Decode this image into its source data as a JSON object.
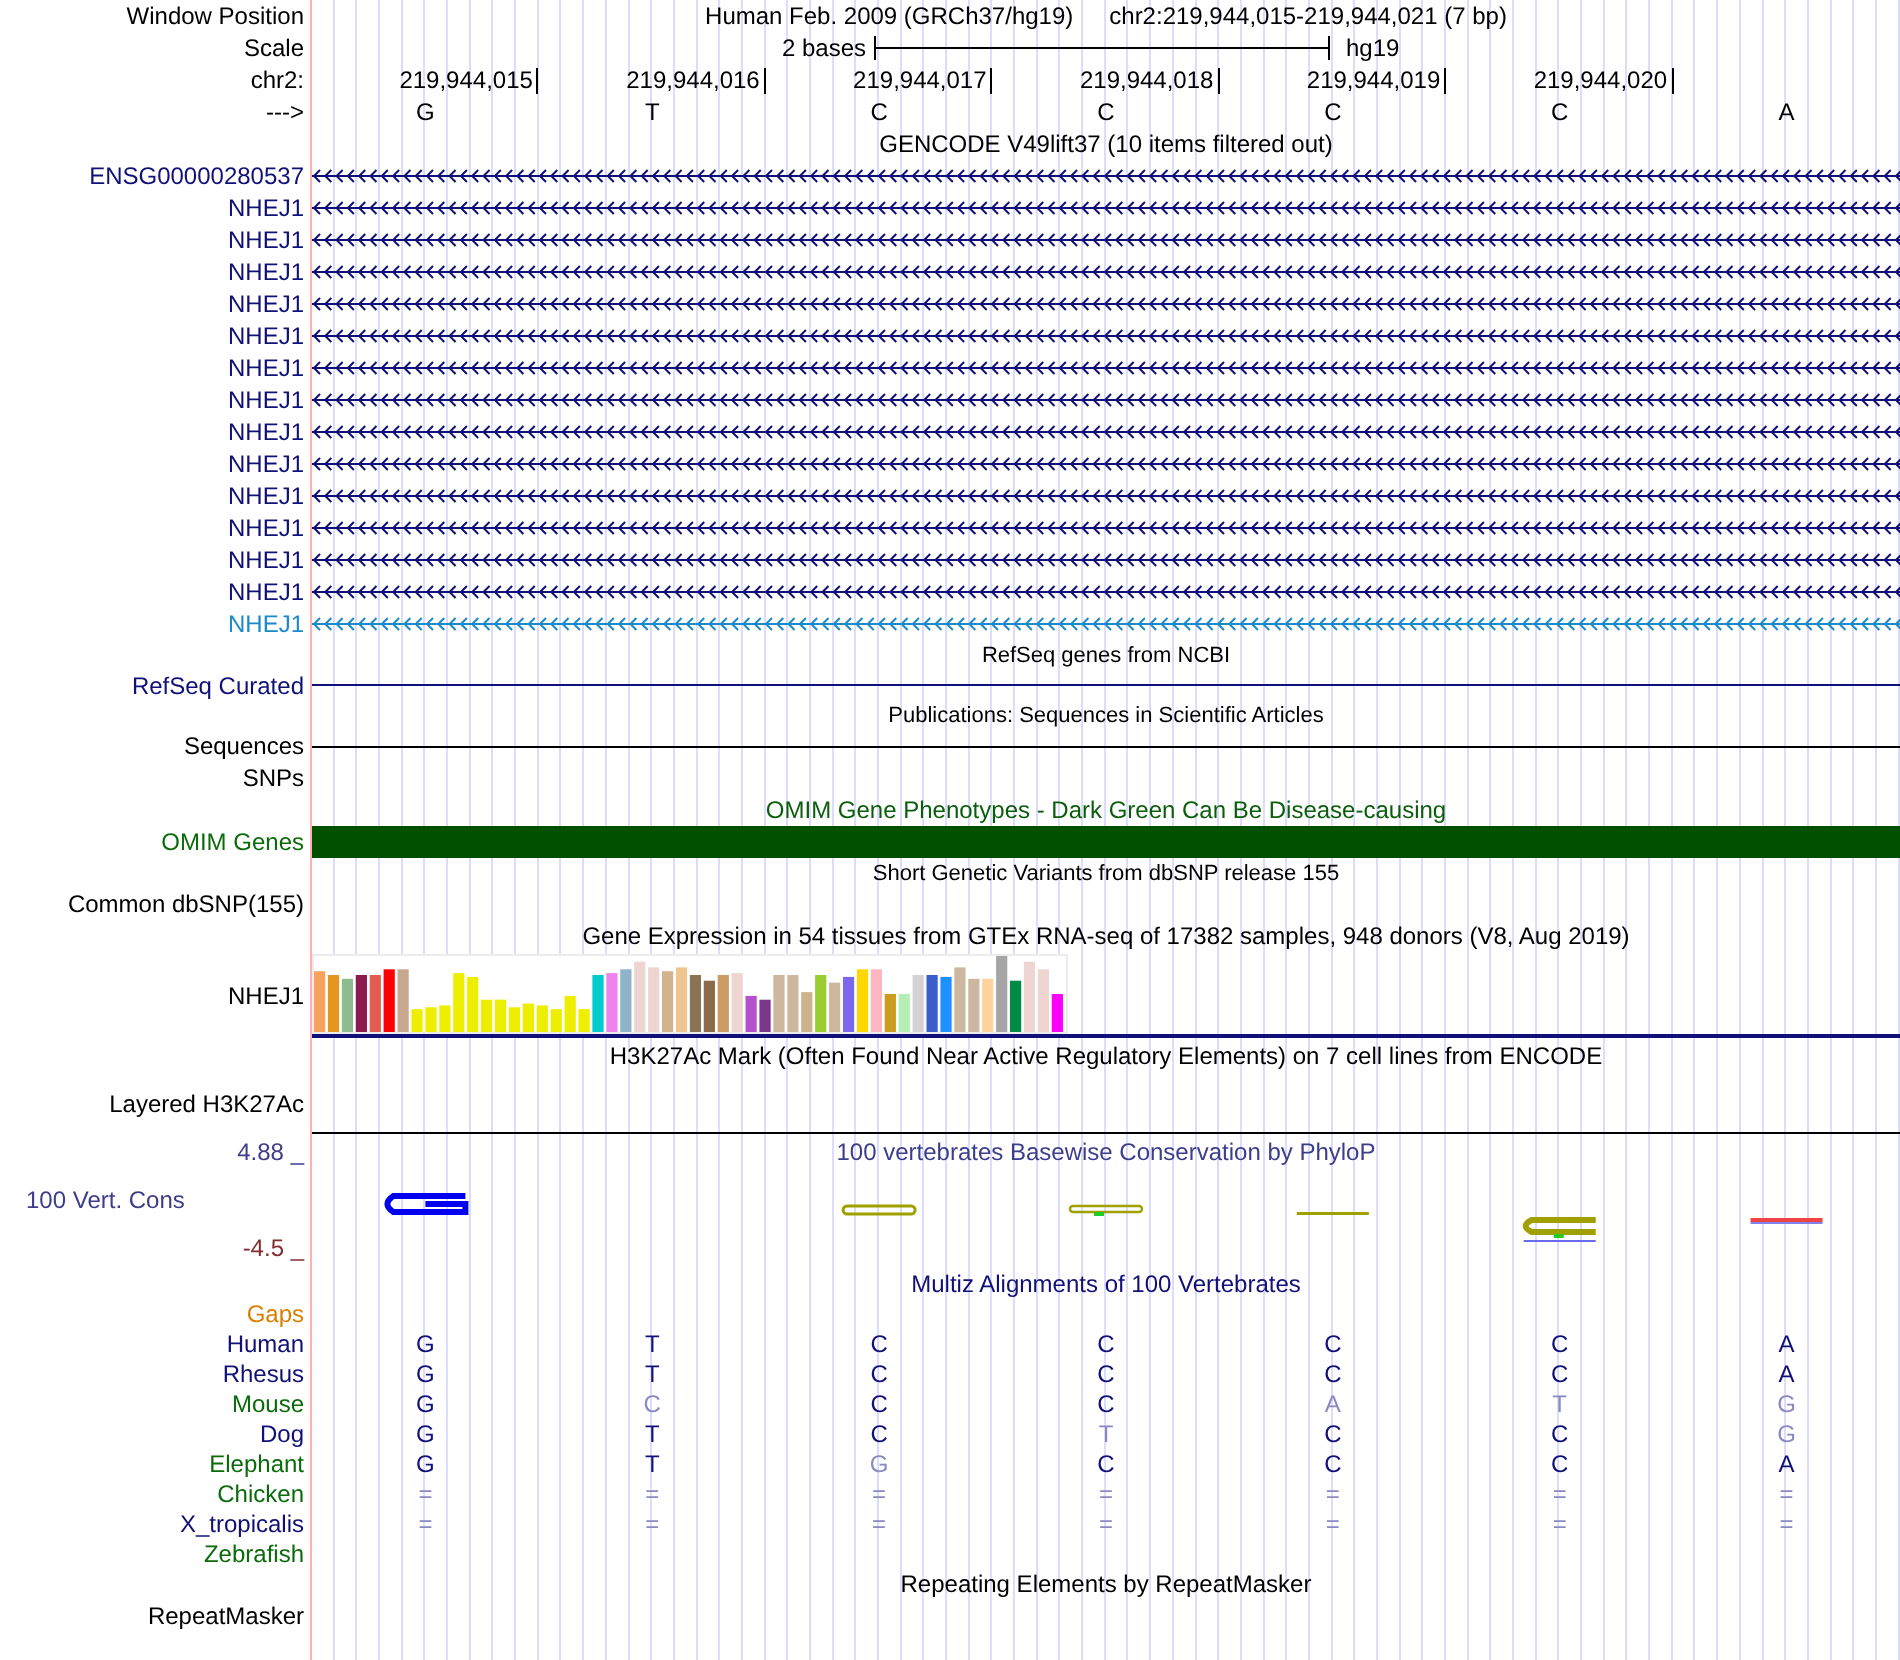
{
  "header": {
    "label": "Window Position",
    "assembly": "Human Feb. 2009 (GRCh37/hg19)",
    "position": "chr2:219,944,015-219,944,021 (7 bp)"
  },
  "scale": {
    "label": "Scale",
    "length": "2 bases",
    "assembly": "hg19"
  },
  "ruler": {
    "label": "chr2:",
    "positions": [
      "219,944,015",
      "219,944,016",
      "219,944,017",
      "219,944,018",
      "219,944,019",
      "219,944,020"
    ]
  },
  "sequence": {
    "label": "--->",
    "bases": [
      "G",
      "T",
      "C",
      "C",
      "C",
      "C",
      "A"
    ]
  },
  "gencode": {
    "title": "GENCODE V49lift37 (10 items filtered out)",
    "genes": [
      {
        "name": "ENSG00000280537",
        "color": "#101078"
      },
      {
        "name": "NHEJ1",
        "color": "#101078"
      },
      {
        "name": "NHEJ1",
        "color": "#101078"
      },
      {
        "name": "NHEJ1",
        "color": "#101078"
      },
      {
        "name": "NHEJ1",
        "color": "#101078"
      },
      {
        "name": "NHEJ1",
        "color": "#101078"
      },
      {
        "name": "NHEJ1",
        "color": "#101078"
      },
      {
        "name": "NHEJ1",
        "color": "#101078"
      },
      {
        "name": "NHEJ1",
        "color": "#101078"
      },
      {
        "name": "NHEJ1",
        "color": "#101078"
      },
      {
        "name": "NHEJ1",
        "color": "#101078"
      },
      {
        "name": "NHEJ1",
        "color": "#101078"
      },
      {
        "name": "NHEJ1",
        "color": "#101078"
      },
      {
        "name": "NHEJ1",
        "color": "#101078"
      },
      {
        "name": "NHEJ1",
        "color": "#1a8acb"
      }
    ]
  },
  "refseq": {
    "title": "RefSeq genes from NCBI",
    "label": "RefSeq Curated"
  },
  "publications": {
    "title": "Publications: Sequences in Scientific Articles",
    "label": "Sequences"
  },
  "snps": {
    "label": "SNPs"
  },
  "omim": {
    "title": "OMIM Gene Phenotypes - Dark Green Can Be Disease-causing",
    "label": "OMIM Genes"
  },
  "dbsnp": {
    "title": "Short Genetic Variants from dbSNP release 155",
    "label": "Common dbSNP(155)"
  },
  "gtex": {
    "title": "Gene Expression in 54 tissues from GTEx RNA-seq of 17382 samples, 948 donors (V8, Aug 2019)",
    "label": "NHEJ1"
  },
  "h3k27ac": {
    "title": "H3K27Ac Mark (Often Found Near Active Regulatory Elements) on 7 cell lines from ENCODE",
    "label": "Layered H3K27Ac"
  },
  "conservation": {
    "title": "100 vertebrates Basewise Conservation by PhyloP",
    "label": "100 Vert. Cons",
    "max": "4.88 _",
    "min": "-4.5 _"
  },
  "multiz": {
    "title": "Multiz Alignments of 100 Vertebrates",
    "gaps_label": "Gaps",
    "species": [
      {
        "name": "Human",
        "color": "#101078",
        "bases": [
          {
            "base": "G",
            "match": true
          },
          {
            "base": "T",
            "match": true
          },
          {
            "base": "C",
            "match": true
          },
          {
            "base": "C",
            "match": true
          },
          {
            "base": "C",
            "match": true
          },
          {
            "base": "C",
            "match": true
          },
          {
            "base": "A",
            "match": true
          }
        ]
      },
      {
        "name": "Rhesus",
        "color": "#101078",
        "bases": [
          {
            "base": "G",
            "match": true
          },
          {
            "base": "T",
            "match": true
          },
          {
            "base": "C",
            "match": true
          },
          {
            "base": "C",
            "match": true
          },
          {
            "base": "C",
            "match": true
          },
          {
            "base": "C",
            "match": true
          },
          {
            "base": "A",
            "match": true
          }
        ]
      },
      {
        "name": "Mouse",
        "color": "#0b6b0b",
        "bases": [
          {
            "base": "G",
            "match": true
          },
          {
            "base": "C",
            "match": false
          },
          {
            "base": "C",
            "match": true
          },
          {
            "base": "C",
            "match": true
          },
          {
            "base": "A",
            "match": false
          },
          {
            "base": "T",
            "match": false
          },
          {
            "base": "G",
            "match": false
          }
        ]
      },
      {
        "name": "Dog",
        "color": "#101078",
        "bases": [
          {
            "base": "G",
            "match": true
          },
          {
            "base": "T",
            "match": true
          },
          {
            "base": "C",
            "match": true
          },
          {
            "base": "T",
            "match": false
          },
          {
            "base": "C",
            "match": true
          },
          {
            "base": "C",
            "match": true
          },
          {
            "base": "G",
            "match": false
          }
        ]
      },
      {
        "name": "Elephant",
        "color": "#0b6b0b",
        "bases": [
          {
            "base": "G",
            "match": true
          },
          {
            "base": "T",
            "match": true
          },
          {
            "base": "G",
            "match": false
          },
          {
            "base": "C",
            "match": true
          },
          {
            "base": "C",
            "match": true
          },
          {
            "base": "C",
            "match": true
          },
          {
            "base": "A",
            "match": true
          }
        ]
      },
      {
        "name": "Chicken",
        "color": "#0b6b0b",
        "bases": [
          {
            "base": "=",
            "match": false
          },
          {
            "base": "=",
            "match": false
          },
          {
            "base": "=",
            "match": false
          },
          {
            "base": "=",
            "match": false
          },
          {
            "base": "=",
            "match": false
          },
          {
            "base": "=",
            "match": false
          },
          {
            "base": "=",
            "match": false
          }
        ]
      },
      {
        "name": "X_tropicalis",
        "color": "#101078",
        "bases": [
          {
            "base": "=",
            "match": false
          },
          {
            "base": "=",
            "match": false
          },
          {
            "base": "=",
            "match": false
          },
          {
            "base": "=",
            "match": false
          },
          {
            "base": "=",
            "match": false
          },
          {
            "base": "=",
            "match": false
          },
          {
            "base": "=",
            "match": false
          }
        ]
      },
      {
        "name": "Zebrafish",
        "color": "#0b6b0b"
      }
    ]
  },
  "repeatmasker": {
    "title": "Repeating Elements by RepeatMasker",
    "label": "RepeatMasker"
  }
}
